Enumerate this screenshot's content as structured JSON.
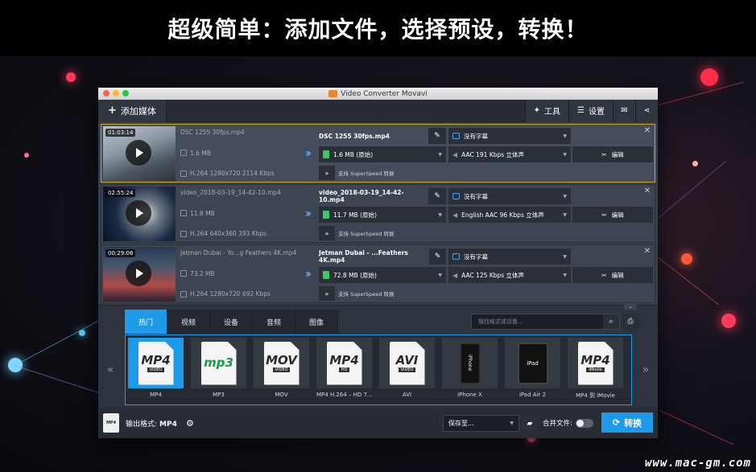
{
  "banner": {
    "headline": "超级简单：添加文件，选择预设，转换！"
  },
  "watermark": "www.mac-gm.com",
  "window": {
    "title": "Video Converter Movavi"
  },
  "toolbar": {
    "add_media": "添加媒体",
    "tools": "工具",
    "settings": "设置"
  },
  "files": [
    {
      "duration": "01:03:14",
      "src_name": "DSC 1255 30fps.mp4",
      "src_size": "1.6 MB",
      "src_codec": "H.264 1280x720 2114 Kbps",
      "dst_name": "DSC 1255 30fps.mp4",
      "dst_size": "1.6 MB (原始)",
      "superspeed": "支持 SuperSpeed 转换",
      "subtitle": "没有字幕",
      "audio": "AAC 191 Kbps 立体声",
      "edit": "编辑",
      "selected": true
    },
    {
      "duration": "02:55:24",
      "src_name": "video_2018-03-19_14-42-10.mp4",
      "src_size": "11.8 MB",
      "src_codec": "H.264 640x360 393 Kbps",
      "dst_name": "video_2018-03-19_14-42-10.mp4",
      "dst_size": "11.7 MB (原始)",
      "superspeed": "支持 SuperSpeed 转换",
      "subtitle": "没有字幕",
      "audio": "English AAC 96 Kbps 立体声",
      "edit": "编辑",
      "selected": false
    },
    {
      "duration": "00:29:06",
      "src_name": "Jetman Dubai - Yo...g Feathers 4K.mp4",
      "src_size": "73.2 MB",
      "src_codec": "H.264 1280x720 692 Kbps",
      "dst_name": "Jetman Dubai - ...Feathers 4K.mp4",
      "dst_size": "72.8 MB (原始)",
      "superspeed": "支持 SuperSpeed 转换",
      "subtitle": "没有字幕",
      "audio": "AAC 125 Kbps 立体声",
      "edit": "编辑",
      "selected": false
    }
  ],
  "format_tabs": [
    "热门",
    "视频",
    "设备",
    "音频",
    "图像"
  ],
  "active_tab": "热门",
  "search": {
    "placeholder": "搜找格式或设备..."
  },
  "formats": [
    {
      "label": "MP4",
      "icon": "MP4",
      "sub": "VIDEO",
      "color": "#2a2a2a",
      "active": true
    },
    {
      "label": "MP3",
      "icon": "mp3",
      "sub": "",
      "color": "#1a9a4a",
      "active": false
    },
    {
      "label": "MOV",
      "icon": "MOV",
      "sub": "VIDEO",
      "color": "#2a2a2a",
      "active": false
    },
    {
      "label": "MP4 H.264 – HD 7...",
      "icon": "MP4",
      "sub": "HD",
      "color": "#2a2a2a",
      "active": false
    },
    {
      "label": "AVI",
      "icon": "AVI",
      "sub": "VIDEO",
      "color": "#2a2a2a",
      "active": false
    },
    {
      "label": "iPhone X",
      "icon": "iPhone",
      "sub": "",
      "color": "#111",
      "active": false
    },
    {
      "label": "iPad Air 2",
      "icon": "iPad",
      "sub": "",
      "color": "#111",
      "active": false
    },
    {
      "label": "MP4 到 iMovie",
      "icon": "MP4",
      "sub": "iMovie",
      "color": "#2a2a2a",
      "active": false
    }
  ],
  "footer": {
    "output_label": "输出格式:",
    "output_value": "MP4",
    "output_icon_text": "MP4",
    "save_to": "保存至...",
    "merge": "合并文件:",
    "convert": "转换"
  }
}
